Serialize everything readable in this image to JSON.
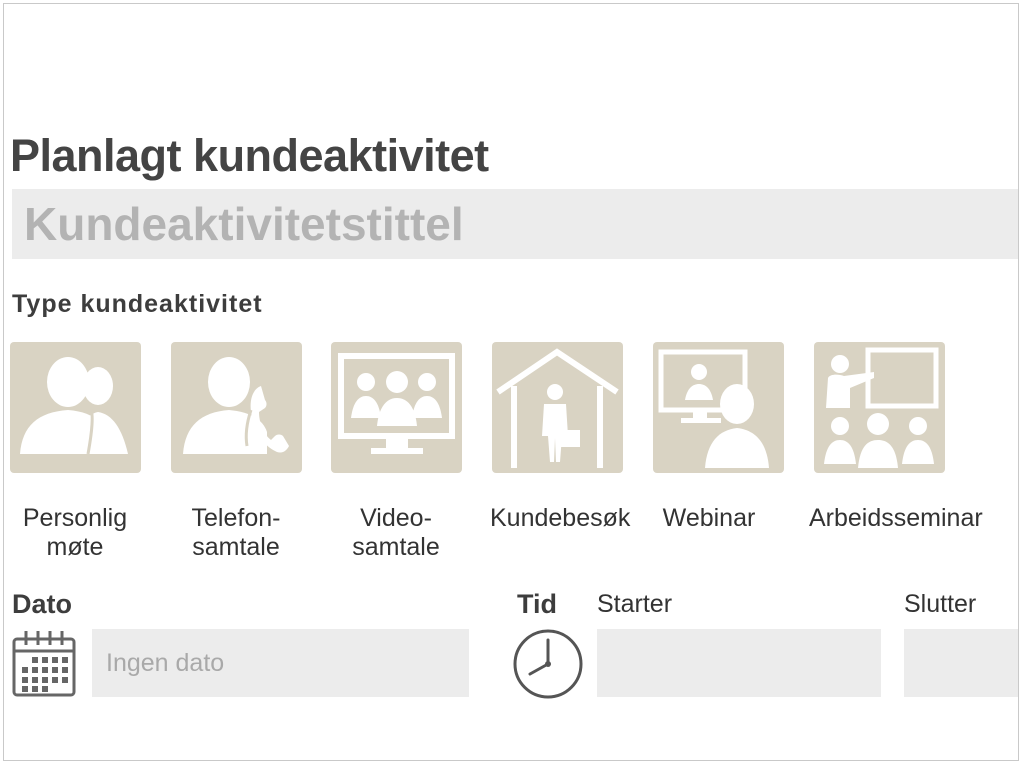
{
  "page": {
    "title": "Planlagt kundeaktivitet",
    "title_placeholder": "Kundeaktivitetstittel",
    "type_section_label": "Type kundeaktivitet",
    "accent_tile_color": "#d9d3c3"
  },
  "activity_types": [
    {
      "label": "Personlig møte",
      "icon": "meeting-people-icon"
    },
    {
      "label": "Telefon-samtale",
      "icon": "phone-call-icon"
    },
    {
      "label": "Video-samtale",
      "icon": "video-conference-icon"
    },
    {
      "label": "Kundebesøk",
      "icon": "customer-visit-icon"
    },
    {
      "label": "Webinar",
      "icon": "webinar-icon"
    },
    {
      "label": "Arbeidsseminar",
      "icon": "workshop-icon"
    }
  ],
  "labels": {
    "personlig_1": "Personlig",
    "personlig_2": "møte",
    "telefon_1": "Telefon-",
    "telefon_2": "samtale",
    "video_1": "Video-",
    "video_2": "samtale",
    "kundebesok": "Kundebesøk",
    "webinar": "Webinar",
    "arbeidsseminar": "Arbeidsseminar"
  },
  "date": {
    "label": "Dato",
    "placeholder": "Ingen dato"
  },
  "time": {
    "label": "Tid",
    "start_label": "Starter",
    "end_label": "Slutter",
    "start_value": "",
    "end_value": ""
  }
}
